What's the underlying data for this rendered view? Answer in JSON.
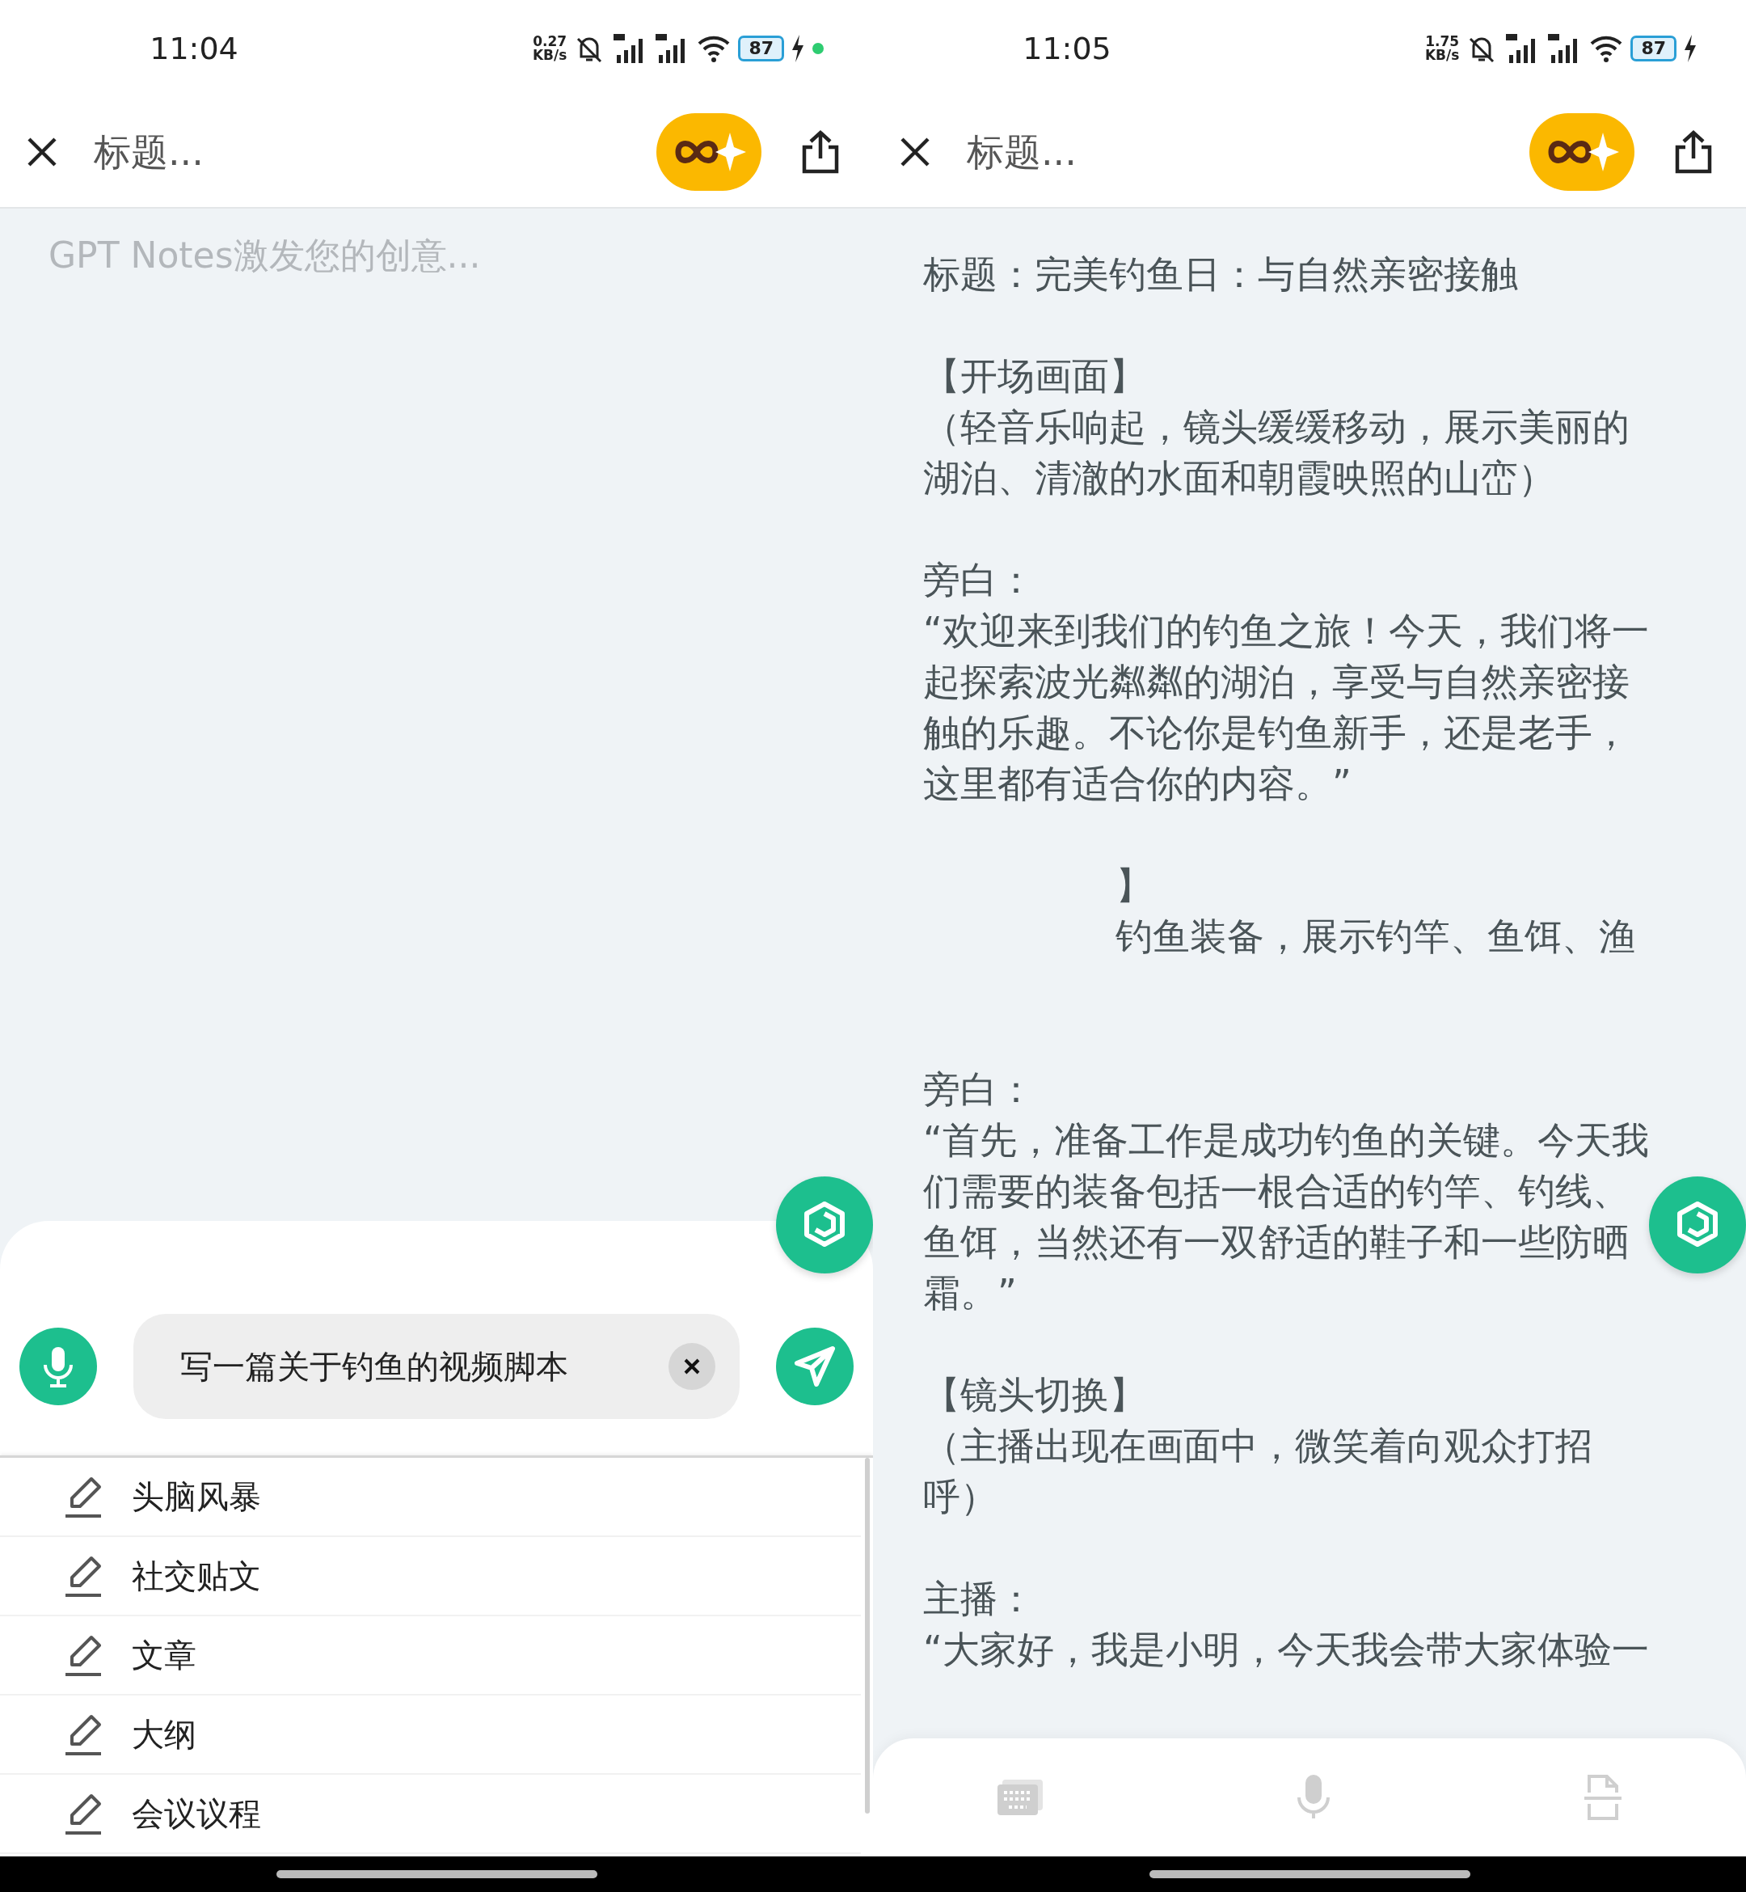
{
  "panes": [
    {
      "kind": "compose",
      "status_bar": {
        "time": "11:04",
        "net_speed": "0.27",
        "net_unit": "KB/s",
        "battery": "87",
        "dot": true
      },
      "header": {
        "title_placeholder": "标题..."
      },
      "editor": {
        "placeholder": "GPT Notes激发您的创意..."
      },
      "prompt": {
        "value": "写一篇关于钓鱼的视频脚本"
      },
      "suggestions": [
        "头脑风暴",
        "社交贴文",
        "文章",
        "大纲",
        "会议议程"
      ]
    },
    {
      "kind": "result",
      "status_bar": {
        "time": "11:05",
        "net_speed": "1.75",
        "net_unit": "KB/s",
        "battery": "87",
        "dot": false
      },
      "header": {
        "title_placeholder": "标题..."
      },
      "paragraphs": [
        {
          "kind": "text",
          "lines": [
            "标题：完美钓鱼日：与自然亲密接触"
          ]
        },
        {
          "kind": "text",
          "lines": [
            "【开场画面】",
            "（轻音乐响起，镜头缓缓移动，展示美丽的",
            "湖泊、清澈的水面和朝霞映照的山峦）"
          ]
        },
        {
          "kind": "text",
          "lines": [
            "旁白：",
            "“欢迎来到我们的钓鱼之旅！今天，我们将一",
            "起探索波光粼粼的湖泊，享受与自然亲密接",
            "触的乐趣。不论你是钓鱼新手，还是老手，",
            "这里都有适合你的内容。”"
          ]
        },
        {
          "kind": "fragment",
          "lines": [
            "】",
            "钓鱼装备，展示钓竿、鱼饵、渔"
          ]
        },
        {
          "kind": "text",
          "lines": [
            "旁白：",
            "“首先，准备工作是成功钓鱼的关键。今天我",
            "们需要的装备包括一根合适的钓竿、钓线、",
            "鱼饵，当然还有一双舒适的鞋子和一些防晒",
            "霜。”"
          ]
        },
        {
          "kind": "text",
          "lines": [
            "【镜头切换】",
            "（主播出现在画面中，微笑着向观众打招",
            "呼）"
          ]
        },
        {
          "kind": "text",
          "lines": [
            "主播：",
            "“大家好，我是小明，今天我会带大家体验一"
          ]
        }
      ]
    }
  ]
}
